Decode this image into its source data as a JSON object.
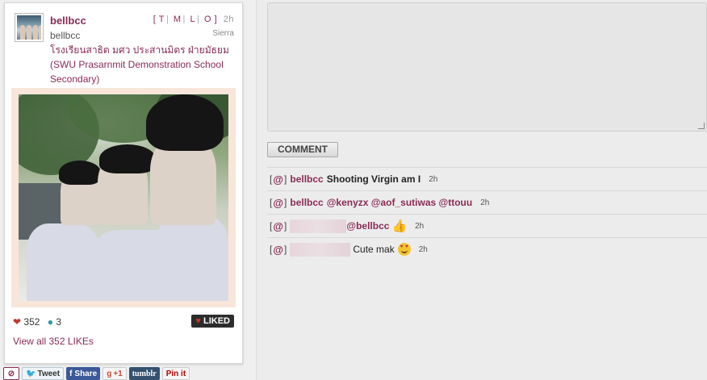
{
  "post": {
    "username": "bellbcc",
    "fullname": "bellbcc",
    "links": [
      "T",
      "M",
      "L",
      "O"
    ],
    "time": "2h",
    "filter": "Sierra",
    "location": "โรงเรียนสาธิต มศว ประสานมิตร ฝ่ายมัธยม (SWU Prasarnmit Demonstration School Secondary)",
    "likes_count": "352",
    "comments_count": "3",
    "liked_label": "LIKED",
    "view_likes": "View all 352 LIKEs"
  },
  "share": {
    "tweet": "Tweet",
    "fb_share": "Share",
    "gplus": "+1",
    "tumblr": "tumblr",
    "pinit": "Pin it"
  },
  "comment_button": "COMMENT",
  "comments": [
    {
      "user": "bellbcc",
      "text": "Shooting Virgin am I",
      "time": "2h"
    },
    {
      "user": "bellbcc",
      "text": "@kenyzx @aof_sutiwas @ttouu",
      "time": "2h"
    },
    {
      "user": "",
      "text": "@bellbcc",
      "time": "2h"
    },
    {
      "user": "",
      "text": "Cute mak",
      "time": "2h"
    }
  ],
  "colors": {
    "accent": "#8a2b55",
    "liked_bg": "#2c2c2c"
  }
}
